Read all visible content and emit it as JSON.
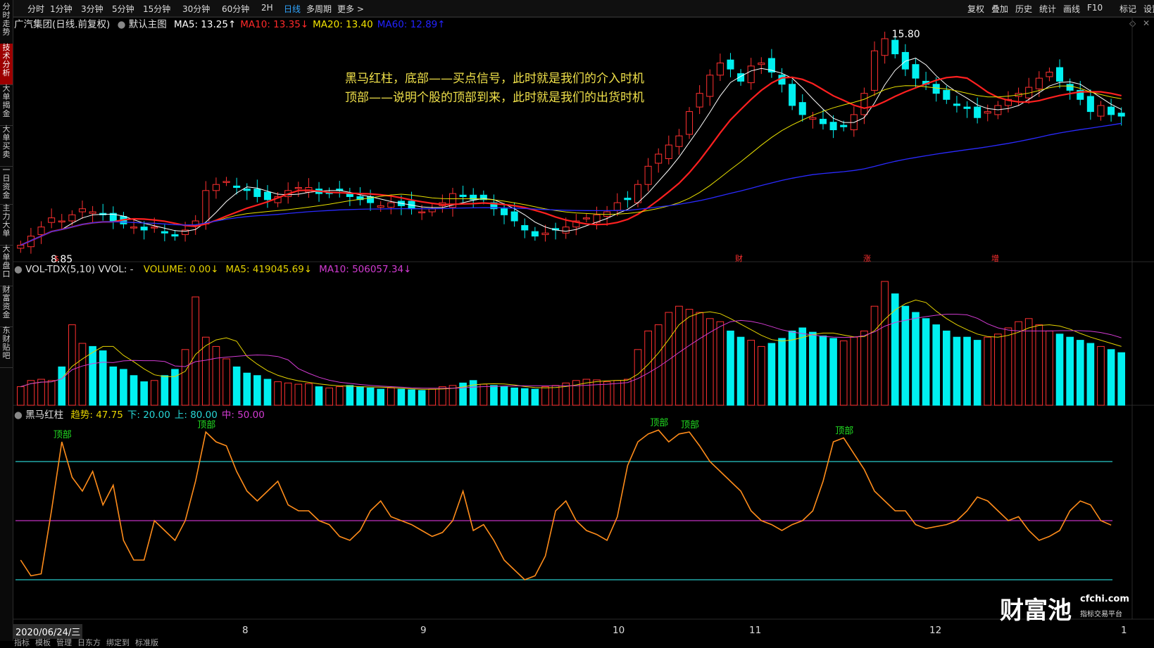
{
  "sidebar": {
    "tabs": [
      {
        "label": "分时走势"
      },
      {
        "label": "技术分析",
        "active": true
      },
      {
        "label": "大单揭金"
      },
      {
        "label": "大单买卖"
      },
      {
        "label": "一日资金"
      },
      {
        "label": "主力大单"
      },
      {
        "label": "大单盘口"
      },
      {
        "label": "财富资金"
      },
      {
        "label": "东财贴吧"
      }
    ]
  },
  "toolbar": {
    "left": [
      "分时",
      "1分钟",
      "3分钟",
      "5分钟",
      "15分钟",
      "30分钟",
      "60分钟",
      "2H",
      "日线",
      "多周期",
      "更多 >"
    ],
    "active": "日线",
    "right": [
      "复权",
      "叠加",
      "历史",
      "统计",
      "画线",
      "F10",
      "标记",
      "设置"
    ]
  },
  "main_panel": {
    "title": "广汽集团(日线.前复权)",
    "template": "默认主图",
    "ma": [
      {
        "label": "MA5: 13.25↑",
        "color": "#ffffff"
      },
      {
        "label": "MA10: 13.35↓",
        "color": "#ff2a2a"
      },
      {
        "label": "MA20: 13.40",
        "color": "#f2e300"
      },
      {
        "label": "MA60: 12.89↑",
        "color": "#2222ff"
      }
    ],
    "high_label": "15.80",
    "low_label": "8.85",
    "events": [
      "$",
      "财",
      "涨",
      "增"
    ],
    "annotation": [
      "黑马红柱，底部——买点信号，此时就是我们的介入时机",
      "顶部——说明个股的顶部到来，此时就是我们的出货时机"
    ]
  },
  "volume_panel": {
    "name": "VOL-TDX(5,10) VVOL: -",
    "items": [
      {
        "label": "VOLUME: 0.00↓",
        "color": "#e6d300"
      },
      {
        "label": "MA5: 419045.69↓",
        "color": "#e6d300"
      },
      {
        "label": "MA10: 506057.34↓",
        "color": "#d23bd2"
      }
    ]
  },
  "indicator_panel": {
    "name": "黑马红柱",
    "items": [
      {
        "label": "趋势: 47.75",
        "color": "#e6d300"
      },
      {
        "label": "下: 20.00",
        "color": "#28d7d7"
      },
      {
        "label": "上: 80.00",
        "color": "#28d7d7"
      },
      {
        "label": "中: 50.00",
        "color": "#d23bd2"
      }
    ],
    "top_label": "顶部"
  },
  "x_axis": {
    "date_label": "2020/06/24/三",
    "ticks": [
      "8",
      "9",
      "10",
      "11",
      "12",
      "1"
    ]
  },
  "bottom_tabs": [
    "指标",
    "模板",
    "管理",
    "日东方",
    "绑定到",
    "标准版"
  ],
  "watermark": {
    "text": "财富池",
    "domain": "cfchi.com",
    "sub": "指标交易平台"
  },
  "colors": {
    "up": "#ff3030",
    "down": "#00f0f0",
    "ma5": "#ffffff",
    "ma10": "#ff2020",
    "ma20": "#e8e000",
    "ma60": "#2a2aff",
    "trend": "#ff8c1a",
    "band": "#28c8c8",
    "mid": "#c030c0"
  },
  "chart_data": [
    {
      "type": "candlestick",
      "title": "广汽集团(日线.前复权)",
      "y_range": [
        8.85,
        15.8
      ],
      "x_ticks": [
        "8",
        "9",
        "10",
        "11",
        "12",
        "1"
      ],
      "close": [
        9.0,
        9.3,
        9.6,
        9.9,
        9.8,
        10.0,
        10.2,
        10.1,
        10.0,
        9.8,
        9.7,
        9.6,
        9.5,
        9.6,
        9.4,
        9.3,
        9.5,
        9.8,
        10.8,
        11.0,
        11.1,
        10.9,
        10.8,
        10.6,
        10.5,
        10.6,
        10.8,
        10.9,
        10.9,
        10.7,
        10.7,
        10.8,
        10.6,
        10.5,
        10.4,
        10.3,
        10.4,
        10.3,
        10.2,
        10.1,
        10.2,
        10.4,
        10.7,
        10.6,
        10.5,
        10.5,
        10.2,
        10.0,
        9.8,
        9.5,
        9.3,
        9.4,
        9.5,
        9.6,
        9.8,
        9.9,
        10.0,
        10.1,
        10.4,
        10.5,
        11.0,
        11.6,
        12.0,
        12.3,
        12.6,
        13.4,
        14.0,
        14.6,
        15.0,
        14.8,
        14.4,
        14.9,
        15.0,
        14.7,
        14.3,
        13.6,
        13.3,
        13.2,
        13.0,
        12.8,
        12.9,
        13.3,
        14.0,
        15.4,
        15.8,
        15.3,
        14.8,
        14.5,
        14.3,
        14.0,
        13.8,
        13.6,
        13.5,
        13.2,
        13.4,
        13.6,
        13.8,
        14.0,
        14.2,
        14.5,
        14.7,
        14.4,
        14.1,
        13.8,
        13.4,
        13.6,
        13.3,
        13.25
      ]
    },
    {
      "type": "bar",
      "title": "VOL-TDX(5,10)",
      "values": [
        30,
        40,
        42,
        40,
        62,
        130,
        100,
        95,
        88,
        62,
        58,
        48,
        38,
        40,
        48,
        58,
        90,
        175,
        110,
        95,
        75,
        62,
        52,
        48,
        42,
        38,
        36,
        34,
        35,
        30,
        28,
        30,
        32,
        30,
        28,
        26,
        28,
        26,
        25,
        24,
        26,
        30,
        32,
        36,
        40,
        34,
        32,
        30,
        28,
        27,
        26,
        30,
        32,
        36,
        40,
        42,
        41,
        38,
        40,
        42,
        90,
        120,
        130,
        150,
        160,
        155,
        150,
        140,
        135,
        120,
        110,
        105,
        95,
        100,
        108,
        120,
        125,
        118,
        112,
        108,
        104,
        110,
        120,
        160,
        200,
        180,
        160,
        150,
        140,
        130,
        120,
        110,
        110,
        105,
        110,
        115,
        125,
        135,
        140,
        130,
        120,
        115,
        110,
        105,
        100,
        95,
        90,
        85
      ]
    },
    {
      "type": "line",
      "title": "黑马红柱",
      "series": [
        {
          "name": "趋势",
          "values": [
            30,
            22,
            23,
            55,
            90,
            72,
            65,
            75,
            58,
            68,
            40,
            30,
            30,
            50,
            45,
            40,
            50,
            70,
            95,
            90,
            88,
            75,
            65,
            60,
            65,
            70,
            58,
            55,
            55,
            50,
            48,
            42,
            40,
            45,
            55,
            60,
            52,
            50,
            48,
            45,
            42,
            44,
            50,
            65,
            45,
            48,
            40,
            30,
            25,
            20,
            22,
            32,
            55,
            60,
            50,
            45,
            43,
            40,
            52,
            78,
            90,
            94,
            96,
            90,
            94,
            95,
            88,
            80,
            75,
            70,
            65,
            55,
            50,
            48,
            45,
            48,
            50,
            55,
            70,
            90,
            92,
            84,
            76,
            65,
            60,
            55,
            55,
            48,
            46,
            47,
            48,
            50,
            55,
            62,
            60,
            55,
            50,
            52,
            45,
            40,
            42,
            45,
            55,
            60,
            58,
            50,
            47.75
          ]
        }
      ],
      "ylim": [
        0,
        100
      ],
      "ref_lines": [
        {
          "name": "下",
          "value": 20
        },
        {
          "name": "上",
          "value": 80
        },
        {
          "name": "中",
          "value": 50
        }
      ]
    }
  ]
}
